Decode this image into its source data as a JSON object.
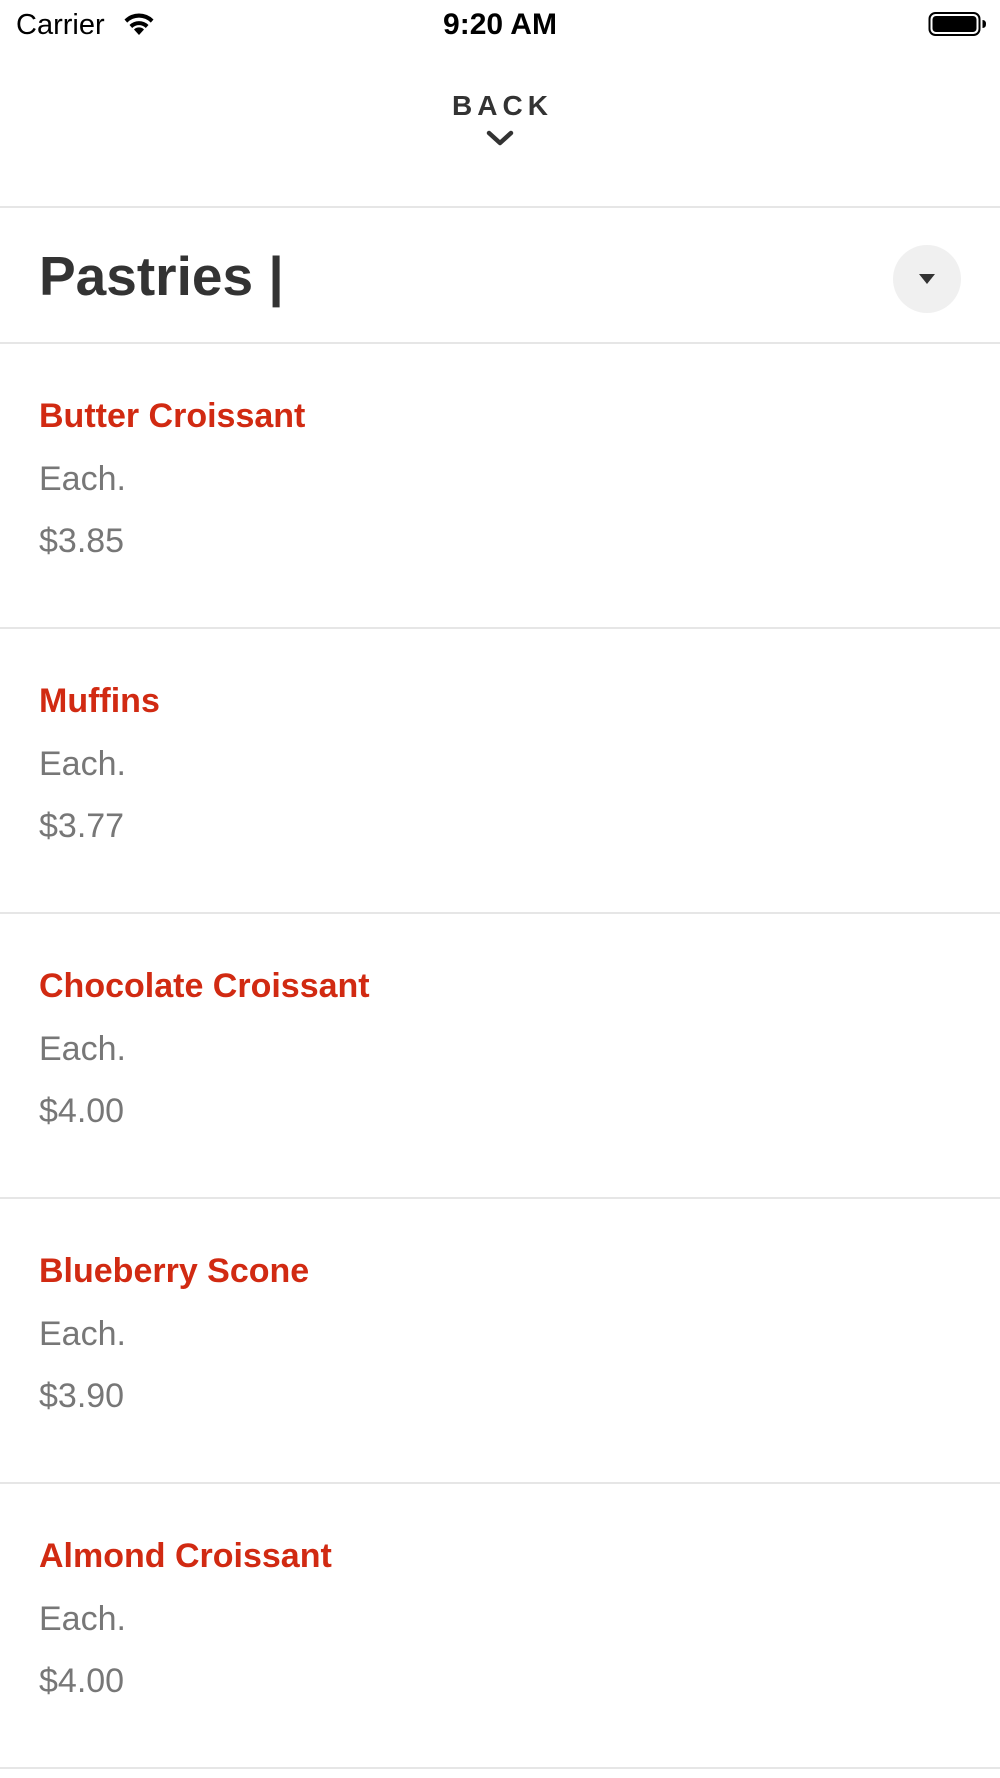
{
  "status_bar": {
    "carrier": "Carrier",
    "time": "9:20 AM",
    "wifi_icon": "wifi-icon",
    "battery_icon": "battery-icon"
  },
  "header": {
    "back_label": "BACK",
    "back_icon": "chevron-down-icon"
  },
  "category": {
    "title": "Pastries |",
    "dropdown_icon": "caret-down-icon"
  },
  "colors": {
    "item_name": "#d12a12",
    "secondary_text": "#777777",
    "primary_text": "#333333",
    "divider": "#e6e6e6"
  },
  "items": [
    {
      "name": "Butter Croissant",
      "unit": "Each.",
      "price": "$3.85"
    },
    {
      "name": "Muffins",
      "unit": "Each.",
      "price": "$3.77"
    },
    {
      "name": "Chocolate Croissant",
      "unit": "Each.",
      "price": "$4.00"
    },
    {
      "name": "Blueberry Scone",
      "unit": "Each.",
      "price": "$3.90"
    },
    {
      "name": "Almond Croissant",
      "unit": "Each.",
      "price": "$4.00"
    }
  ]
}
